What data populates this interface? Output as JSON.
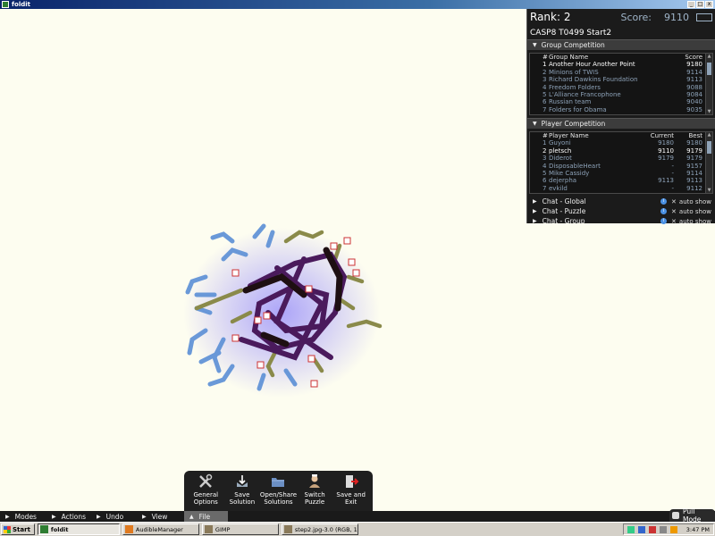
{
  "window": {
    "title": "foldit",
    "controls": [
      "_",
      "□",
      "x"
    ]
  },
  "panel": {
    "rank_label": "Rank: 2",
    "score_label": "Score:",
    "score_value": "9110",
    "puzzle_title": "CASP8 T0499 Start2",
    "group_section": "Group Competition",
    "group_headers": {
      "num": "#",
      "name": "Group Name",
      "score": "Score"
    },
    "groups": [
      {
        "num": "1",
        "name": "Another Hour Another Point",
        "score": "9180"
      },
      {
        "num": "2",
        "name": "Minions of TWIS",
        "score": "9114"
      },
      {
        "num": "3",
        "name": "Richard Dawkins Foundation",
        "score": "9113"
      },
      {
        "num": "4",
        "name": "Freedom Folders",
        "score": "9088"
      },
      {
        "num": "5",
        "name": "L'Alliance Francophone",
        "score": "9084"
      },
      {
        "num": "6",
        "name": "Russian team",
        "score": "9040"
      },
      {
        "num": "7",
        "name": "Folders for Obama",
        "score": "9035"
      }
    ],
    "player_section": "Player Competition",
    "player_headers": {
      "num": "#",
      "name": "Player Name",
      "current": "Current",
      "best": "Best"
    },
    "players": [
      {
        "num": "1",
        "name": "Guyoni",
        "current": "9180",
        "best": "9180"
      },
      {
        "num": "2",
        "name": "pletsch",
        "current": "9110",
        "best": "9179"
      },
      {
        "num": "3",
        "name": "Diderot",
        "current": "9179",
        "best": "9179"
      },
      {
        "num": "4",
        "name": "DisposableHeart",
        "current": "-",
        "best": "9157"
      },
      {
        "num": "5",
        "name": "Mike Cassidy",
        "current": "-",
        "best": "9114"
      },
      {
        "num": "6",
        "name": "dejerpha",
        "current": "9113",
        "best": "9113"
      },
      {
        "num": "7",
        "name": "evkild",
        "current": "-",
        "best": "9112"
      }
    ],
    "chats": [
      {
        "label": "Chat - Global",
        "auto": "auto show"
      },
      {
        "label": "Chat - Puzzle",
        "auto": "auto show"
      },
      {
        "label": "Chat - Group",
        "auto": "auto show"
      }
    ]
  },
  "actions": [
    {
      "line1": "General",
      "line2": "Options",
      "icon": "tools-icon"
    },
    {
      "line1": "Save",
      "line2": "Solution",
      "icon": "save-icon"
    },
    {
      "line1": "Open/Share",
      "line2": "Solutions",
      "icon": "folder-icon"
    },
    {
      "line1": "Switch",
      "line2": "Puzzle",
      "icon": "switch-puzzle-icon"
    },
    {
      "line1": "Save and",
      "line2": "Exit",
      "icon": "exit-icon"
    }
  ],
  "menus": [
    "Modes",
    "Actions",
    "Undo",
    "View",
    "File"
  ],
  "pull_mode": "Pull Mode",
  "taskbar": {
    "start": "Start",
    "tasks": [
      "foldit",
      "AudibleManager",
      "GIMP",
      "step2.jpg-3.0 (RGB, 1 la..."
    ],
    "clock": "3:47 PM"
  },
  "colors": {
    "panel_bg": "#1b1b1b",
    "dim_text": "#8da2b8",
    "viewport_bg": "#fdfdf0",
    "backbone": "#4a1a5c",
    "sidechain_blue": "#5b8fd6",
    "sidechain_olive": "#8a8a4a"
  }
}
